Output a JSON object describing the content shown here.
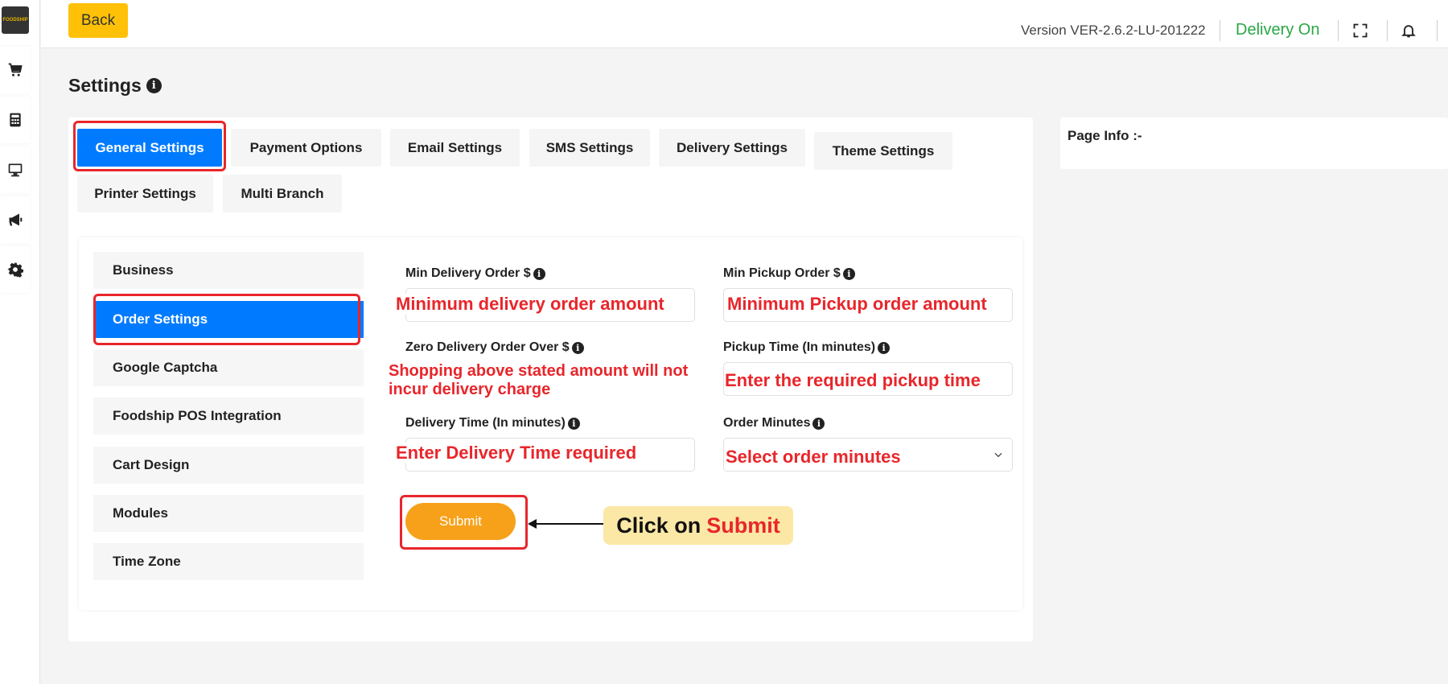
{
  "app": {
    "logo_text": "FOODSHIP",
    "version": "Version VER-2.6.2-LU-201222",
    "delivery_status": "Delivery On",
    "back_label": "Back"
  },
  "sidebar": {
    "icons": [
      "cart-icon",
      "calculator-icon",
      "monitor-icon",
      "megaphone-icon",
      "gear-icon"
    ]
  },
  "page": {
    "title": "Settings",
    "info_panel_title": "Page Info :-"
  },
  "tabs": [
    {
      "label": "General Settings",
      "active": true
    },
    {
      "label": "Payment Options"
    },
    {
      "label": "Email Settings"
    },
    {
      "label": "SMS Settings"
    },
    {
      "label": "Delivery Settings"
    },
    {
      "label": "Theme Settings"
    },
    {
      "label": "Printer Settings"
    },
    {
      "label": "Multi Branch"
    }
  ],
  "nav": [
    {
      "label": "Business"
    },
    {
      "label": "Order Settings",
      "active": true
    },
    {
      "label": "Google Captcha"
    },
    {
      "label": "Foodship POS Integration"
    },
    {
      "label": "Cart Design"
    },
    {
      "label": "Modules"
    },
    {
      "label": "Time Zone"
    }
  ],
  "form": {
    "min_delivery_label": "Min Delivery Order $",
    "min_pickup_label": "Min Pickup Order $",
    "zero_delivery_label": "Zero Delivery Order Over $",
    "pickup_time_label": "Pickup Time (In minutes)",
    "delivery_time_label": "Delivery Time (In minutes)",
    "order_minutes_label": "Order Minutes",
    "submit_label": "Submit"
  },
  "annotations": {
    "min_delivery": "Minimum delivery order amount",
    "min_pickup": "Minimum Pickup order amount",
    "zero_delivery": "Shopping above stated amount will not incur delivery charge",
    "pickup_time": "Enter the required pickup time",
    "delivery_time": "Enter Delivery Time required",
    "order_minutes": "Select order minutes",
    "callout_prefix": "Click on",
    "callout_target": "Submit"
  },
  "colors": {
    "primary": "#007bff",
    "accent": "#ffc107",
    "submit": "#f7a11a",
    "highlight": "#e8262b",
    "success": "#28a745"
  }
}
